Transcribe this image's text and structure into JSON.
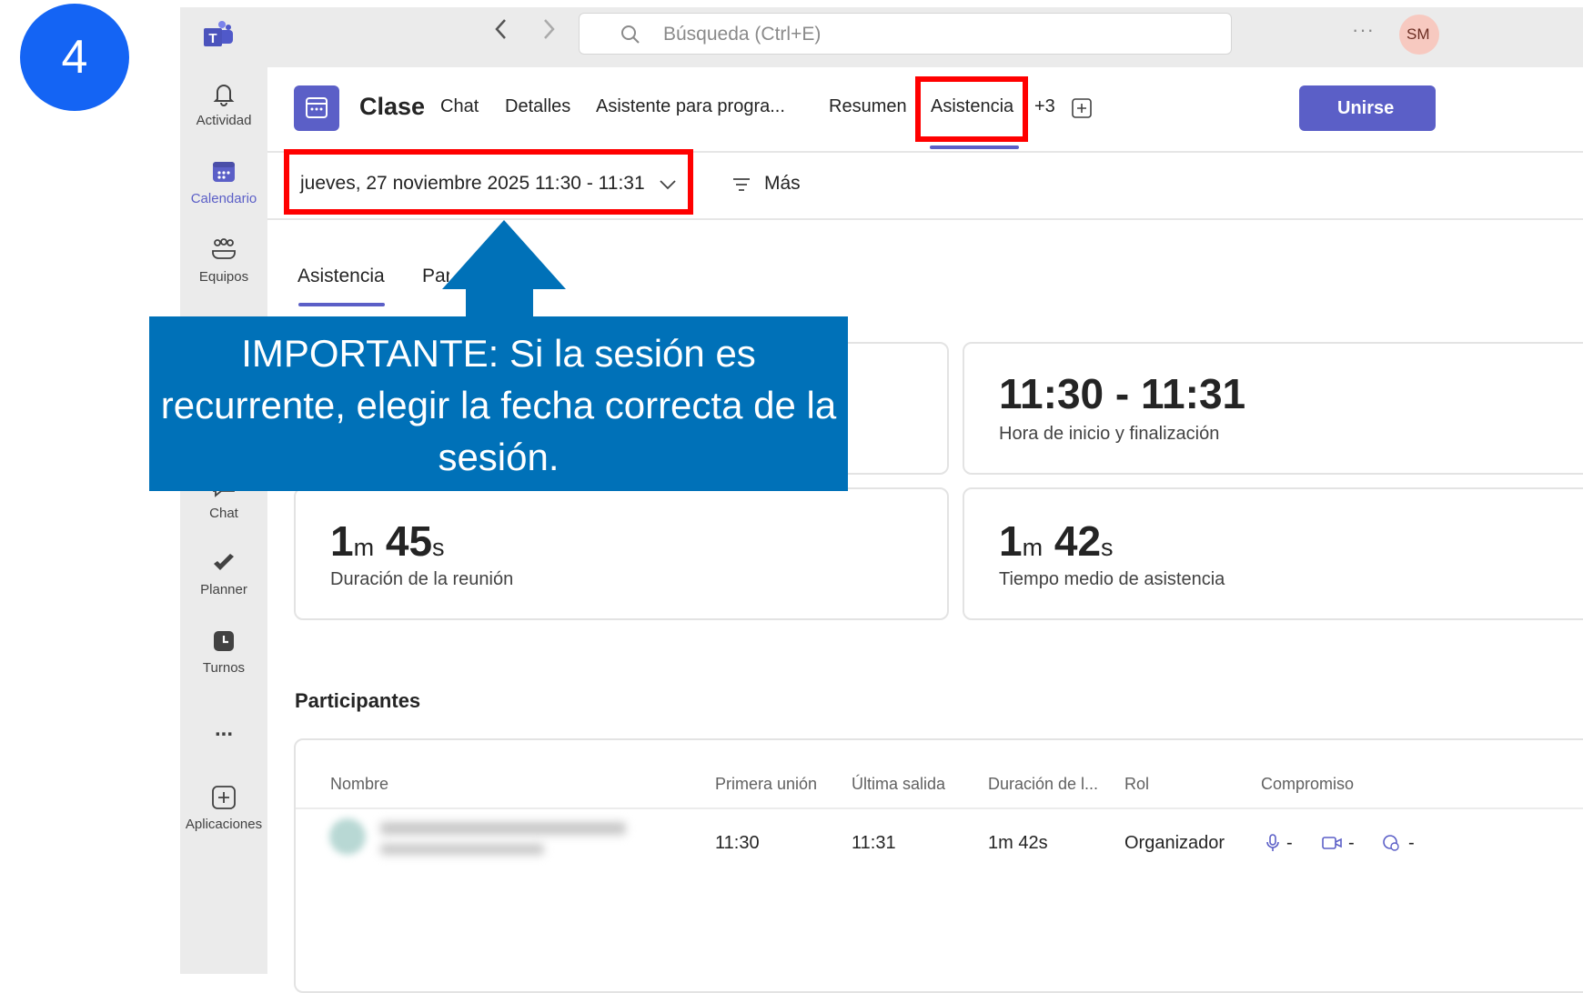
{
  "step": {
    "number": "4"
  },
  "titlebar": {
    "search_placeholder": "Búsqueda (Ctrl+E)",
    "avatar_initials": "SM",
    "back_icon": "chevron-left-icon",
    "forward_icon": "chevron-right-icon"
  },
  "rail": {
    "items": [
      {
        "label": "Actividad",
        "icon": "bell-icon"
      },
      {
        "label": "Calendario",
        "icon": "calendar-icon",
        "active": true
      },
      {
        "label": "Equipos",
        "icon": "teams-icon"
      },
      {
        "label": "Chat",
        "icon": "chat-icon"
      },
      {
        "label": "Planner",
        "icon": "planner-icon"
      },
      {
        "label": "Turnos",
        "icon": "shifts-icon"
      },
      {
        "label": "Aplicaciones",
        "icon": "add-app-icon"
      }
    ],
    "more": "..."
  },
  "header": {
    "title": "Clase",
    "tabs": [
      "Chat",
      "Detalles",
      "Asistente para progra...",
      "Resumen",
      "Asistencia",
      "+3"
    ],
    "active_tab": "Asistencia",
    "join_label": "Unirse"
  },
  "session": {
    "date_label": "jueves, 27 noviembre 2025 11:30 - 11:31",
    "more_label": "Más"
  },
  "subtabs": {
    "active": "Asistencia",
    "second": "Participantes"
  },
  "stats": {
    "time_range": "11:30 - 11:31",
    "time_range_label": "Hora de inicio y finalización",
    "duration_min": "1",
    "duration_sec": "45",
    "duration_label": "Duración de la reunión",
    "avg_min": "1",
    "avg_sec": "42",
    "avg_label": "Tiempo medio de asistencia",
    "unit_m": "m",
    "unit_s": "s"
  },
  "participants": {
    "title": "Participantes",
    "columns": [
      "Nombre",
      "Primera unión",
      "Última salida",
      "Duración de l...",
      "Rol",
      "Compromiso"
    ],
    "rows": [
      {
        "first_join": "11:30",
        "last_leave": "11:31",
        "duration": "1m 42s",
        "role": "Organizador",
        "mic": "-",
        "camera": "-",
        "reactions": "-"
      }
    ]
  },
  "callout": {
    "bold": "IMPORTANTE",
    "text": ": Si la sesión es recurrente, elegir la fecha correcta de la sesión."
  },
  "colors": {
    "accent": "#5b5fc7",
    "highlight": "#ff0000",
    "callout": "#0071b8",
    "badge": "#1464f4"
  }
}
